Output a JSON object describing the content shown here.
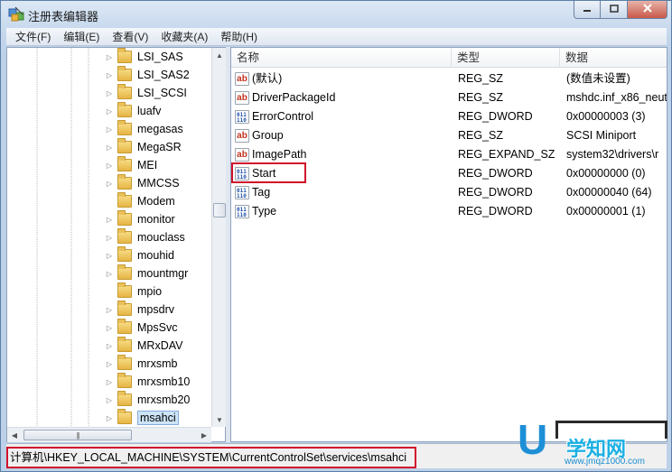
{
  "window": {
    "title": "注册表编辑器",
    "controls": {
      "minimize": "▭",
      "maximize": "◻",
      "close": "✕"
    }
  },
  "menu": [
    "文件(F)",
    "编辑(E)",
    "查看(V)",
    "收藏夹(A)",
    "帮助(H)"
  ],
  "tree": {
    "items": [
      {
        "label": "LSI_SAS",
        "expandable": true
      },
      {
        "label": "LSI_SAS2",
        "expandable": true
      },
      {
        "label": "LSI_SCSI",
        "expandable": true
      },
      {
        "label": "luafv",
        "expandable": true
      },
      {
        "label": "megasas",
        "expandable": true
      },
      {
        "label": "MegaSR",
        "expandable": true
      },
      {
        "label": "MEI",
        "expandable": true
      },
      {
        "label": "MMCSS",
        "expandable": true
      },
      {
        "label": "Modem",
        "expandable": false
      },
      {
        "label": "monitor",
        "expandable": true
      },
      {
        "label": "mouclass",
        "expandable": true
      },
      {
        "label": "mouhid",
        "expandable": true
      },
      {
        "label": "mountmgr",
        "expandable": true
      },
      {
        "label": "mpio",
        "expandable": false
      },
      {
        "label": "mpsdrv",
        "expandable": true
      },
      {
        "label": "MpsSvc",
        "expandable": true
      },
      {
        "label": "MRxDAV",
        "expandable": true
      },
      {
        "label": "mrxsmb",
        "expandable": true
      },
      {
        "label": "mrxsmb10",
        "expandable": true
      },
      {
        "label": "mrxsmb20",
        "expandable": true
      },
      {
        "label": "msahci",
        "expandable": true,
        "selected": true
      }
    ]
  },
  "list": {
    "columns": [
      "名称",
      "类型",
      "数据"
    ],
    "rows": [
      {
        "name": "(默认)",
        "type": "REG_SZ",
        "data": "(数值未设置)",
        "icon": "sz"
      },
      {
        "name": "DriverPackageId",
        "type": "REG_SZ",
        "data": "mshdc.inf_x86_neut",
        "icon": "sz"
      },
      {
        "name": "ErrorControl",
        "type": "REG_DWORD",
        "data": "0x00000003 (3)",
        "icon": "dw"
      },
      {
        "name": "Group",
        "type": "REG_SZ",
        "data": "SCSI Miniport",
        "icon": "sz"
      },
      {
        "name": "ImagePath",
        "type": "REG_EXPAND_SZ",
        "data": "system32\\drivers\\r",
        "icon": "sz"
      },
      {
        "name": "Start",
        "type": "REG_DWORD",
        "data": "0x00000000 (0)",
        "icon": "dw"
      },
      {
        "name": "Tag",
        "type": "REG_DWORD",
        "data": "0x00000040 (64)",
        "icon": "dw"
      },
      {
        "name": "Type",
        "type": "REG_DWORD",
        "data": "0x00000001 (1)",
        "icon": "dw"
      }
    ],
    "icon_glyphs": {
      "sz": "ab",
      "dw": "011\n110"
    }
  },
  "status": {
    "path": "计算机\\HKEY_LOCAL_MACHINE\\SYSTEM\\CurrentControlSet\\services\\msahci"
  },
  "watermark": {
    "letter": "U",
    "brand": "学知网",
    "url": "www.jmqz1000.com"
  },
  "colors": {
    "highlight": "#d0102a",
    "selection": "#cde4f7",
    "accent": "#1d8fd6"
  }
}
